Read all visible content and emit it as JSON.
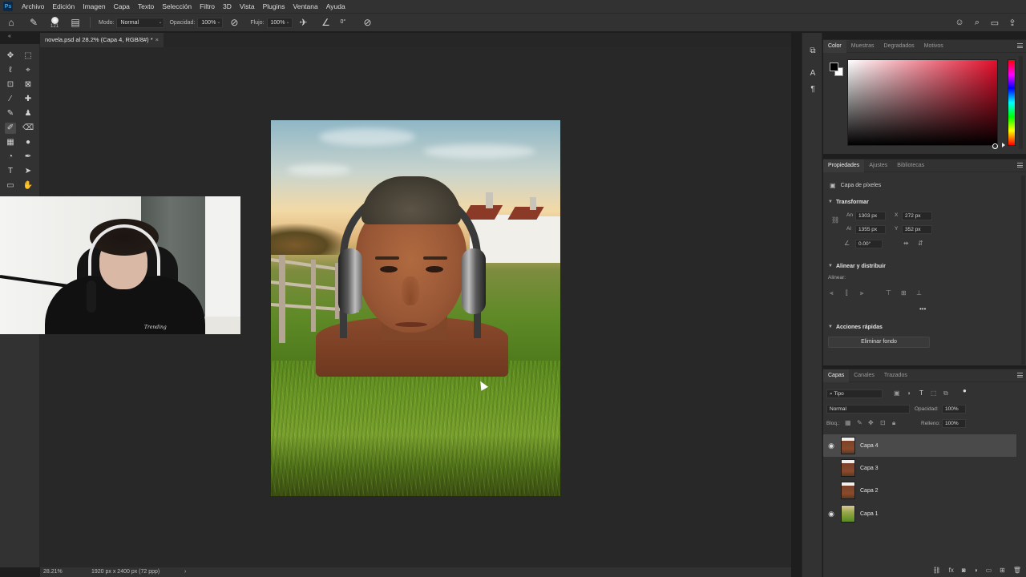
{
  "menubar": {
    "items": [
      "Archivo",
      "Edición",
      "Imagen",
      "Capa",
      "Texto",
      "Selección",
      "Filtro",
      "3D",
      "Vista",
      "Plugins",
      "Ventana",
      "Ayuda"
    ]
  },
  "options": {
    "brush_size": "121",
    "mode_label": "Modo:",
    "mode_value": "Normal",
    "opacity_label": "Opacidad:",
    "opacity_value": "100%",
    "flow_label": "Flujo:",
    "flow_value": "100%",
    "angle_value": "0°"
  },
  "document": {
    "tab_title": "novela.psd al 28.2% (Capa 4, RGB/8#) *",
    "tab_close": "×"
  },
  "status": {
    "zoom": "28.21%",
    "dimensions": "1920 px x 2400 px (72 ppp)",
    "arrow": "›"
  },
  "color_panel": {
    "tabs": [
      "Color",
      "Muestras",
      "Degradados",
      "Motivos"
    ],
    "active_tab": 0
  },
  "properties_panel": {
    "tabs": [
      "Propiedades",
      "Ajustes",
      "Bibliotecas"
    ],
    "layer_type": "Capa de píxeles",
    "transform_header": "Transformar",
    "w_label": "An",
    "w_value": "1303 px",
    "x_label": "X",
    "x_value": "272 px",
    "h_label": "Al",
    "h_value": "1355 px",
    "y_label": "Y",
    "y_value": "352 px",
    "angle_value": "0.00°",
    "align_header": "Alinear y distribuir",
    "align_label": "Alinear:",
    "more": "•••",
    "quick_header": "Acciones rápidas",
    "remove_bg_button": "Eliminar fondo"
  },
  "layers_panel": {
    "tabs": [
      "Capas",
      "Canales",
      "Trazados"
    ],
    "filter_value": "Tipo",
    "blend_mode": "Normal",
    "opacity_label": "Opacidad:",
    "opacity_value": "100%",
    "lock_label": "Bloq.:",
    "fill_label": "Relleno:",
    "fill_value": "100%",
    "layers": [
      {
        "name": "Capa 4",
        "visible": true,
        "selected": true
      },
      {
        "name": "Capa 3",
        "visible": false,
        "selected": false
      },
      {
        "name": "Capa 2",
        "visible": false,
        "selected": false
      },
      {
        "name": "Capa 1",
        "visible": true,
        "selected": false
      }
    ]
  },
  "webcam": {
    "shirt_text": "Trending"
  },
  "colors": {
    "accent_blue": "#31a8ff",
    "panel_bg": "#323232",
    "workspace_bg": "#282828",
    "selected_layer": "#4a4a4a"
  }
}
